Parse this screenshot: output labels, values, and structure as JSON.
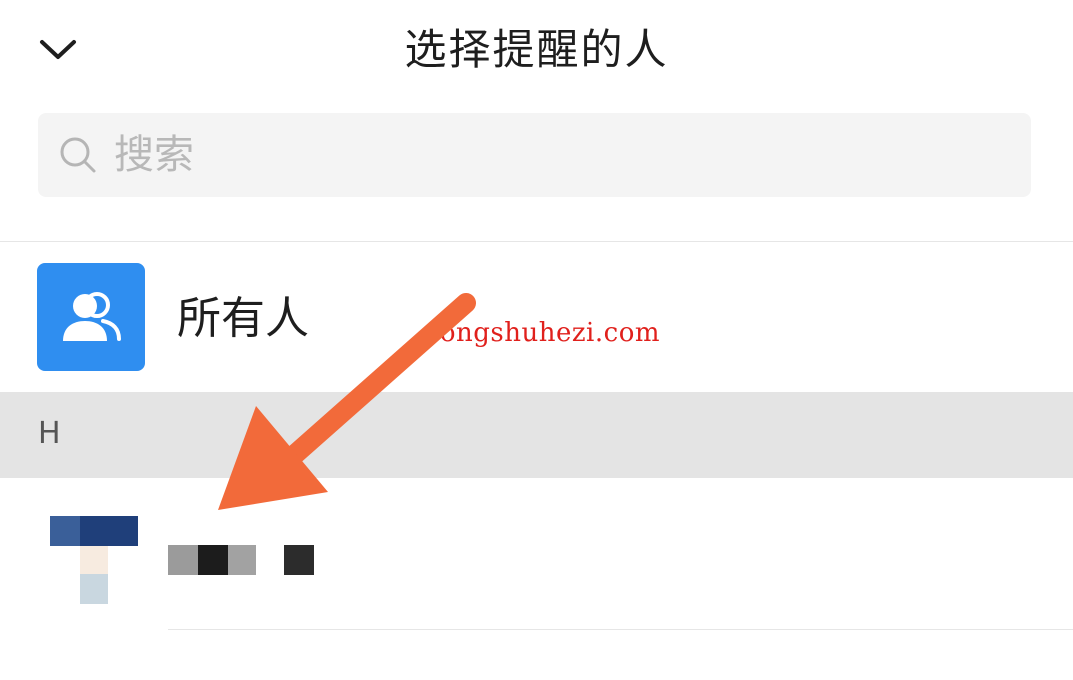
{
  "header": {
    "title": "选择提醒的人",
    "back_icon": "chevron-down-icon"
  },
  "search": {
    "placeholder": "搜索",
    "value": "",
    "icon": "search-icon"
  },
  "everyone": {
    "label": "所有人",
    "icon": "group-icon",
    "color": "#2f8ef0"
  },
  "watermark": "songshuhezi.com",
  "sections": [
    {
      "letter": "H",
      "contacts": [
        {
          "name": "",
          "avatar": "avatar"
        }
      ]
    }
  ],
  "colors": {
    "accent": "#2f8ef0",
    "arrow": "#f26a3a",
    "section_bg": "#e4e4e4",
    "watermark": "#e0201c"
  }
}
